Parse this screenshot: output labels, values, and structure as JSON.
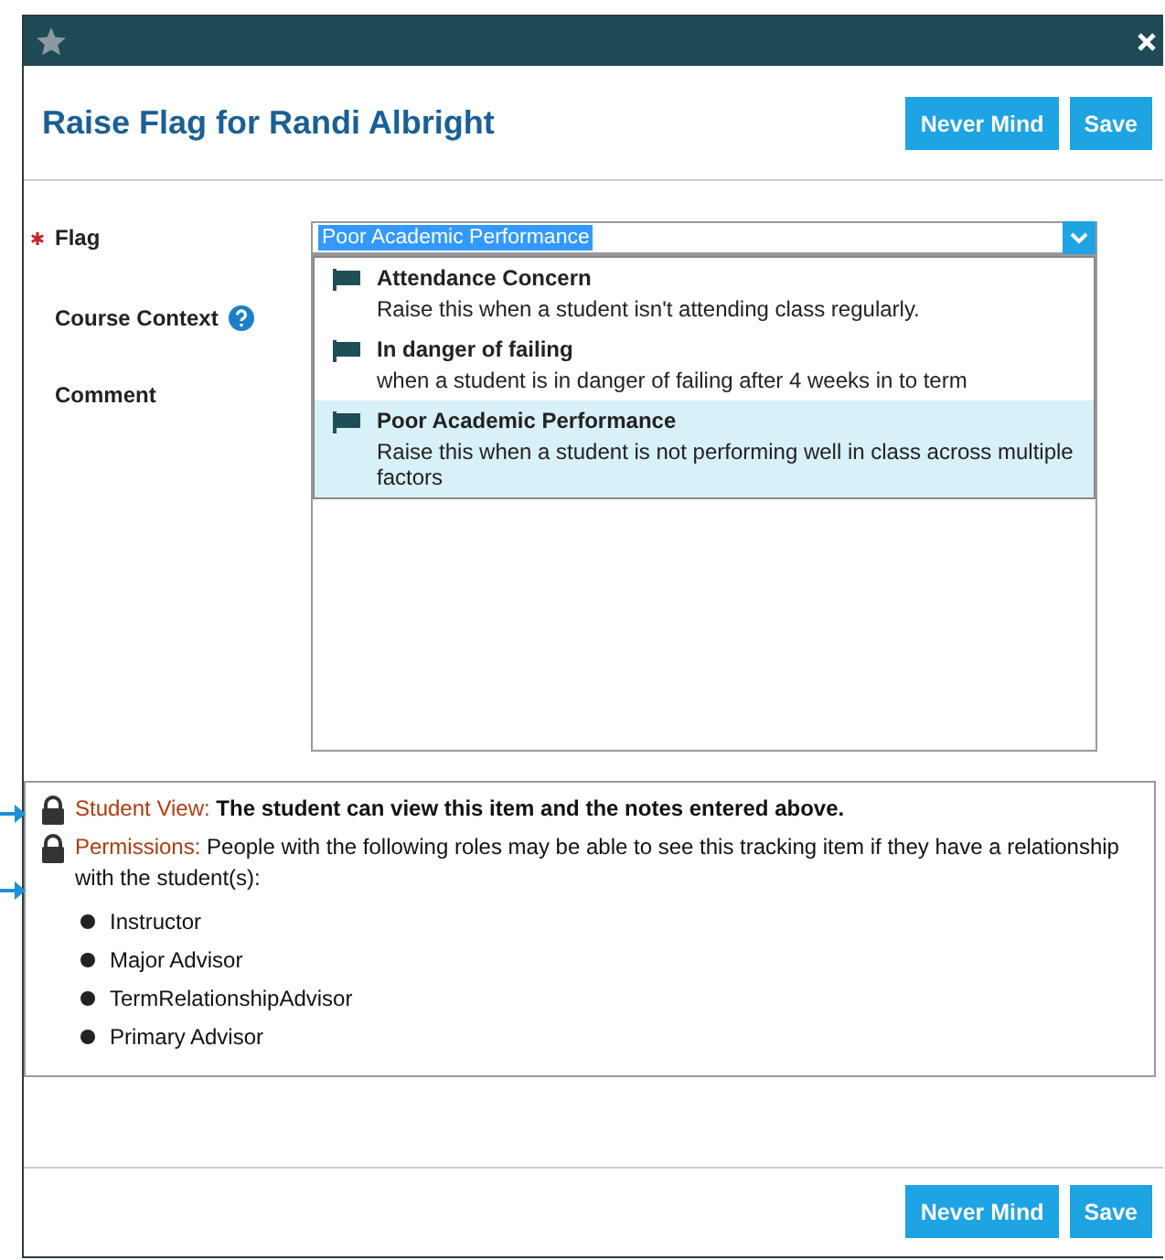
{
  "window": {
    "title": "Raise Flag for Randi Albright"
  },
  "header_buttons": [
    {
      "label": "Never Mind"
    },
    {
      "label": "Save"
    }
  ],
  "form": {
    "flag": {
      "label": "Flag",
      "required": true,
      "value": "Poor Academic Performance",
      "expanded": true,
      "options": [
        {
          "title": "Attendance Concern",
          "description": "Raise this when a student isn't attending class regularly.",
          "selected": false
        },
        {
          "title": "In danger of failing",
          "description": "when a student is in danger of failing after 4 weeks in to term",
          "selected": false
        },
        {
          "title": "Poor Academic Performance",
          "description": "Raise this when a student is not performing well in class across multiple factors",
          "selected": true
        }
      ]
    },
    "course_context": {
      "label": "Course Context"
    },
    "comment": {
      "label": "Comment"
    }
  },
  "info": {
    "student_view": {
      "label": "Student View:",
      "text": "The student can view this item and the notes entered above."
    },
    "permissions": {
      "label": "Permissions:",
      "text": "People with the following roles may be able to see this tracking item if they have a relationship with the student(s):",
      "roles": [
        "Instructor",
        "Major Advisor",
        "TermRelationshipAdvisor",
        "Primary Advisor"
      ]
    }
  },
  "footer_buttons": [
    {
      "label": "Never Mind"
    },
    {
      "label": "Save"
    }
  ]
}
